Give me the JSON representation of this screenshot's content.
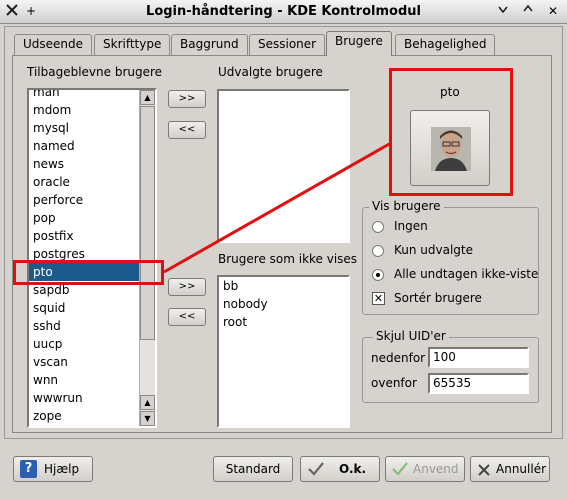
{
  "window": {
    "title": "Login-håndtering - KDE Kontrolmodul",
    "close_glyph": "✕",
    "pin_glyph": "+"
  },
  "tabs": [
    {
      "label": "Udseende",
      "active": false
    },
    {
      "label": "Skrifttype",
      "active": false
    },
    {
      "label": "Baggrund",
      "active": false
    },
    {
      "label": "Sessioner",
      "active": false
    },
    {
      "label": "Brugere",
      "active": true
    },
    {
      "label": "Behagelighed",
      "active": false
    }
  ],
  "remaining_users": {
    "label": "Tilbageblevne brugere",
    "items": [
      "man",
      "mdom",
      "mysql",
      "named",
      "news",
      "oracle",
      "perforce",
      "pop",
      "postfix",
      "postgres",
      "pto",
      "sapdb",
      "squid",
      "sshd",
      "uucp",
      "vscan",
      "wnn",
      "wwwrun",
      "zope"
    ],
    "selected": "pto"
  },
  "transfer_buttons": {
    "add": ">>",
    "remove": "<<"
  },
  "selected_users": {
    "label": "Udvalgte brugere",
    "items": []
  },
  "hidden_users": {
    "label": "Brugere som ikke vises",
    "items": [
      "bb",
      "nobody",
      "root"
    ]
  },
  "user_preview": {
    "name": "pto"
  },
  "show_users_group": {
    "title": "Vis brugere",
    "options": [
      {
        "label": "Ingen",
        "checked": false
      },
      {
        "label": "Kun udvalgte",
        "checked": false
      },
      {
        "label": "Alle undtagen ikke-viste",
        "checked": true
      }
    ],
    "sort_label": "Sortér brugere",
    "sort_checked": true
  },
  "hide_uid_group": {
    "title": "Skjul UID'er",
    "below_label": "nedenfor",
    "below_value": "100",
    "above_label": "ovenfor",
    "above_value": "65535"
  },
  "bottom_buttons": {
    "help": "Hjælp",
    "default": "Standard",
    "ok": "O.k.",
    "apply": "Anvend",
    "cancel": "Annullér"
  },
  "colors": {
    "selection": "#1c5a8c",
    "highlight": "#e01010"
  }
}
